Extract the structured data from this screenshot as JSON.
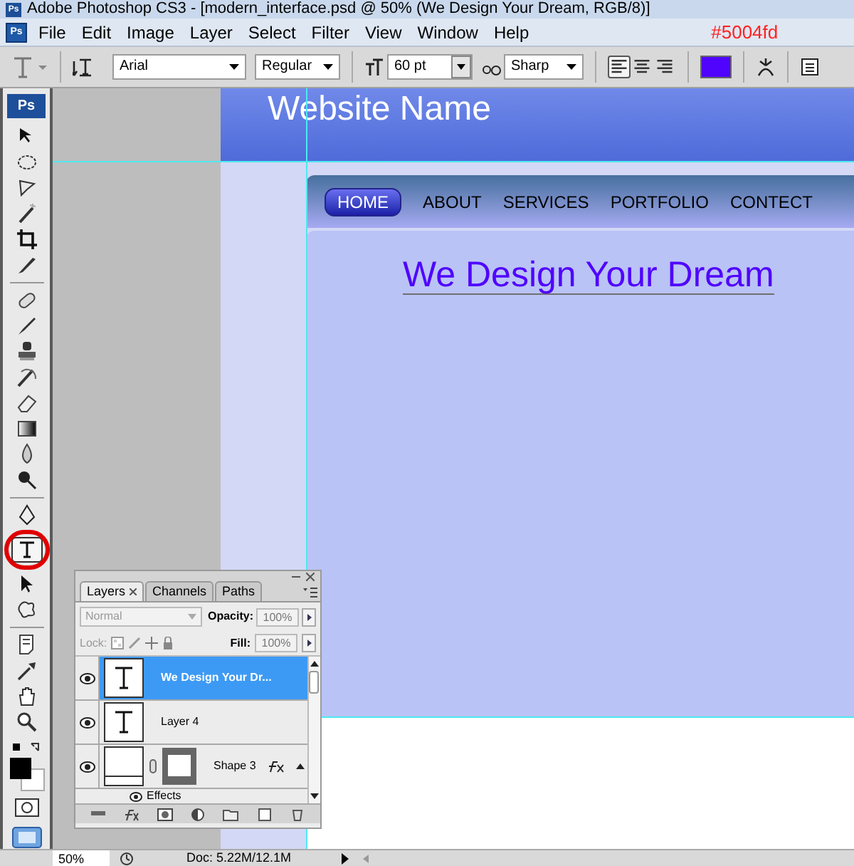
{
  "window": {
    "title": "Adobe Photoshop CS3 - [modern_interface.psd @ 50% (We Design Your Dream, RGB/8)]",
    "logo": "Ps"
  },
  "menu": {
    "logo": "Ps",
    "items": [
      "File",
      "Edit",
      "Image",
      "Layer",
      "Select",
      "Filter",
      "View",
      "Window",
      "Help"
    ]
  },
  "options_bar": {
    "font_family": "Arial",
    "font_style": "Regular",
    "font_size": "60 pt",
    "antialias": "Sharp",
    "text_color": "#5004fd",
    "align": [
      {
        "kind": "left",
        "selected": true
      },
      {
        "kind": "center",
        "selected": false
      },
      {
        "kind": "right",
        "selected": false
      }
    ]
  },
  "toolbox": {
    "logo": "Ps",
    "tools": [
      {
        "kind": "move",
        "selected": false
      },
      {
        "kind": "marquee",
        "selected": false
      },
      {
        "kind": "lasso",
        "selected": false
      },
      {
        "kind": "wand",
        "selected": false
      },
      {
        "kind": "crop",
        "selected": false
      },
      {
        "kind": "slice",
        "selected": false
      },
      {
        "kind": "separator"
      },
      {
        "kind": "heal",
        "selected": false
      },
      {
        "kind": "brush",
        "selected": false
      },
      {
        "kind": "stamp",
        "selected": false
      },
      {
        "kind": "history",
        "selected": false
      },
      {
        "kind": "eraser",
        "selected": false
      },
      {
        "kind": "gradient",
        "selected": false
      },
      {
        "kind": "blur",
        "selected": false
      },
      {
        "kind": "dodge",
        "selected": false
      },
      {
        "kind": "separator"
      },
      {
        "kind": "pen",
        "selected": false
      },
      {
        "kind": "type",
        "selected": true
      },
      {
        "kind": "select",
        "selected": false
      },
      {
        "kind": "shape",
        "selected": false
      },
      {
        "kind": "separator"
      },
      {
        "kind": "notes",
        "selected": false
      },
      {
        "kind": "eyedropper",
        "selected": false
      },
      {
        "kind": "hand",
        "selected": false
      },
      {
        "kind": "zoom",
        "selected": false
      }
    ]
  },
  "canvas": {
    "site_name": "Website Name",
    "headline": "We Design Your Dream",
    "nav": [
      {
        "label": "HOME",
        "selected": true
      },
      {
        "label": "ABOUT",
        "selected": false
      },
      {
        "label": "SERVICES",
        "selected": false
      },
      {
        "label": "PORTFOLIO",
        "selected": false
      },
      {
        "label": "CONTECT",
        "selected": false
      }
    ]
  },
  "layers_panel": {
    "tabs": [
      {
        "label": "Layers",
        "selected": true
      },
      {
        "label": "Channels",
        "selected": false
      },
      {
        "label": "Paths",
        "selected": false
      }
    ],
    "blend_mode": "Normal",
    "opacity_label": "Opacity:",
    "opacity": "100%",
    "lock_label": "Lock:",
    "fill_label": "Fill:",
    "fill": "100%",
    "layers": [
      {
        "kind": "text",
        "name": "We Design Your Dr...",
        "selected": true,
        "visible": true
      },
      {
        "kind": "text",
        "name": "Layer 4",
        "selected": false,
        "visible": true
      },
      {
        "kind": "shape",
        "name": "Shape 3",
        "selected": false,
        "visible": true,
        "effects_label": "Effects"
      }
    ]
  },
  "status_bar": {
    "zoom": "50%",
    "doc": "Doc: 5.22M/12.1M"
  }
}
